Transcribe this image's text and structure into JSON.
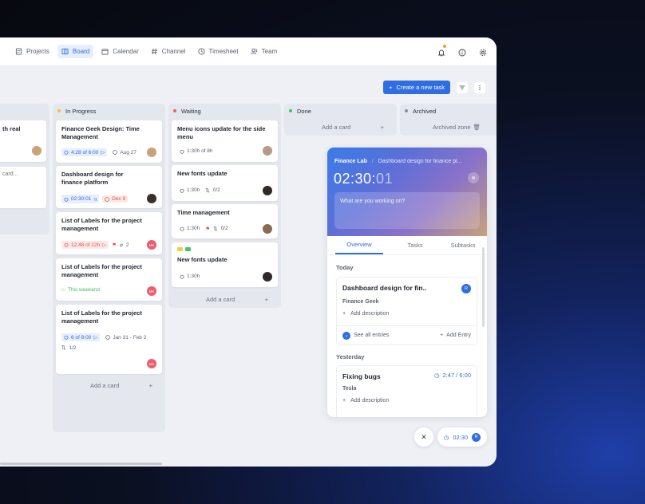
{
  "nav": {
    "items": [
      {
        "label": "Projects"
      },
      {
        "label": "Board"
      },
      {
        "label": "Calendar"
      },
      {
        "label": "Channel"
      },
      {
        "label": "Timesheet"
      },
      {
        "label": "Team"
      }
    ],
    "active": "Board"
  },
  "toolbar": {
    "create_label": "Create a new task"
  },
  "columns": {
    "partial": {
      "card1_title": "th real",
      "card2_text": "card..."
    },
    "inprogress": {
      "title": "In Progress",
      "cards": [
        {
          "title": "Finance Geek Design: Time Management",
          "time": "4:28 of 6:00",
          "date": "Aug 27"
        },
        {
          "title": "Dashboard design for finance platform",
          "time": "02:30:01",
          "date": "Dec 9"
        },
        {
          "title": "List of Labels for the project management",
          "time": "12:48 of 12h",
          "count": "2",
          "avatar": "MK"
        },
        {
          "title": "List of Labels for the project management",
          "label": "This weekend",
          "avatar": "MK"
        },
        {
          "title": "List of Labels for the project management",
          "time": "6 of 8:00",
          "date": "Jan 31 - Feb 2",
          "sub": "1/2",
          "avatar": "MK"
        }
      ],
      "add": "Add a card"
    },
    "waiting": {
      "title": "Waiting",
      "cards": [
        {
          "title": "Menu icons update for the side menu",
          "time": "1:30h of 8h"
        },
        {
          "title": "New fonts update",
          "time": "1:30h",
          "sub": "0/2"
        },
        {
          "title": "Time management",
          "time": "1:30h",
          "sub": "0/2"
        },
        {
          "title": "New fonts update",
          "time": "1:30h"
        }
      ],
      "add": "Add a card"
    },
    "done": {
      "title": "Done",
      "add": "Add a card"
    },
    "archived": {
      "title": "Archived",
      "zone": "Archived zone"
    }
  },
  "timer": {
    "lab": "Finance Lab",
    "task": "Dashboard design for finance pl...",
    "time_main": "02:30:",
    "time_sec": "01",
    "placeholder": "What are you working on?",
    "tabs": [
      "Overview",
      "Tasks",
      "Subtasks"
    ],
    "today_label": "Today",
    "today_entry": {
      "title": "Dashboard design for fin..",
      "project": "Finance Geek",
      "add_desc": "Add description",
      "see_all": "See all entries",
      "add_entry": "Add Entry",
      "avatar": "R"
    },
    "yesterday_label": "Yesterday",
    "yesterday_entry": {
      "title": "Fixing bugs",
      "time": "2:47 / 6:00",
      "project": "Tesla",
      "add_desc": "Add description"
    }
  },
  "floating": {
    "time": "02:30",
    "avatar": "R"
  },
  "colors": {
    "accent": "#2f6de0",
    "waiting_dot": "#ef5c6b",
    "done_dot": "#3bbf6a",
    "inprogress_dot": "#f0c040"
  }
}
